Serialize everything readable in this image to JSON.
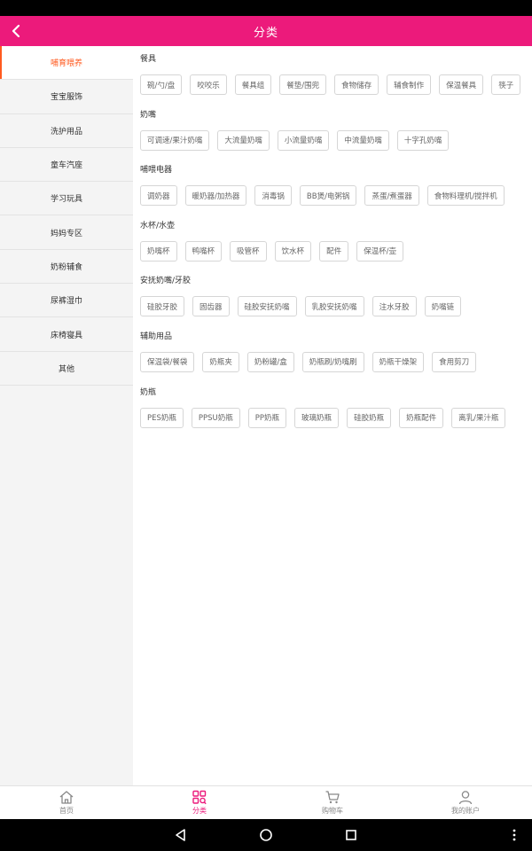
{
  "header": {
    "title": "分类"
  },
  "sidebar": {
    "items": [
      {
        "label": "哺育喂养",
        "active": true
      },
      {
        "label": "宝宝服饰"
      },
      {
        "label": "洗护用品"
      },
      {
        "label": "童车汽座"
      },
      {
        "label": "学习玩具"
      },
      {
        "label": "妈妈专区"
      },
      {
        "label": "奶粉辅食"
      },
      {
        "label": "尿裤湿巾"
      },
      {
        "label": "床椅寝具"
      },
      {
        "label": "其他"
      }
    ]
  },
  "sections": [
    {
      "title": "餐具",
      "tags": [
        "碗/勺/盘",
        "咬咬乐",
        "餐具组",
        "餐垫/围兜",
        "食物储存",
        "辅食制作",
        "保温餐具",
        "筷子"
      ]
    },
    {
      "title": "奶嘴",
      "tags": [
        "可调速/果汁奶嘴",
        "大流量奶嘴",
        "小流量奶嘴",
        "中流量奶嘴",
        "十字孔奶嘴"
      ]
    },
    {
      "title": "哺喂电器",
      "tags": [
        "调奶器",
        "暖奶器/加热器",
        "消毒锅",
        "BB煲/电粥锅",
        "蒸蛋/煮蛋器",
        "食物料理机/搅拌机"
      ]
    },
    {
      "title": "水杯/水壶",
      "tags": [
        "奶嘴杯",
        "鸭嘴杯",
        "吸管杯",
        "饮水杯",
        "配件",
        "保温杯/壶"
      ]
    },
    {
      "title": "安抚奶嘴/牙胶",
      "tags": [
        "硅胶牙胶",
        "固齿器",
        "硅胶安抚奶嘴",
        "乳胶安抚奶嘴",
        "注水牙胶",
        "奶嘴链"
      ]
    },
    {
      "title": "辅助用品",
      "tags": [
        "保温袋/餐袋",
        "奶瓶夹",
        "奶粉罐/盒",
        "奶瓶刷/奶嘴刷",
        "奶瓶干燥架",
        "食用剪刀"
      ]
    },
    {
      "title": "奶瓶",
      "tags": [
        "PES奶瓶",
        "PPSU奶瓶",
        "PP奶瓶",
        "玻璃奶瓶",
        "硅胶奶瓶",
        "奶瓶配件",
        "离乳/果汁瓶"
      ]
    }
  ],
  "tabbar": {
    "items": [
      {
        "label": "首页",
        "icon": "home-icon"
      },
      {
        "label": "分类",
        "icon": "category-icon",
        "active": true
      },
      {
        "label": "购物车",
        "icon": "cart-icon"
      },
      {
        "label": "我的账户",
        "icon": "account-icon"
      }
    ]
  },
  "colors": {
    "brand": "#ec1a7b",
    "active_sidebar": "#ff5a1f"
  }
}
